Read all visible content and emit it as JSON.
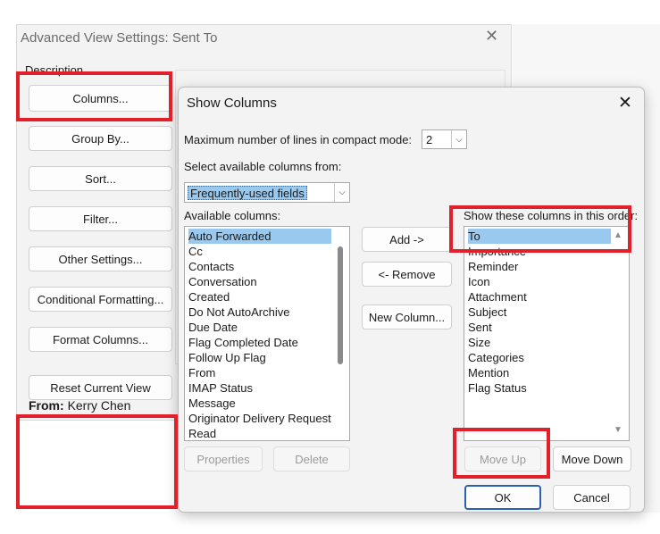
{
  "background_window": {
    "title": "Advanced View Settings: Sent To",
    "description_label": "Description",
    "buttons": {
      "columns": "Columns...",
      "group_by": "Group By...",
      "sort": "Sort...",
      "filter": "Filter...",
      "other_settings": "Other Settings...",
      "conditional_formatting": "Conditional Formatting...",
      "format_columns": "Format Columns...",
      "reset_current_view": "Reset Current View"
    },
    "from_label": "From:",
    "from_value": "Kerry Chen"
  },
  "dialog": {
    "title": "Show Columns",
    "max_lines_label": "Maximum number of lines in compact mode:",
    "max_lines_value": "2",
    "select_from_label": "Select available columns from:",
    "select_from_value": "Frequently-used fields",
    "available_label": "Available columns:",
    "available_items": [
      "Auto Forwarded",
      "Cc",
      "Contacts",
      "Conversation",
      "Created",
      "Do Not AutoArchive",
      "Due Date",
      "Flag Completed Date",
      "Follow Up Flag",
      "From",
      "IMAP Status",
      "Message",
      "Originator Delivery Request",
      "Read"
    ],
    "available_selected": "Auto Forwarded",
    "show_label": "Show these columns in this order:",
    "show_items": [
      "To",
      "Importance",
      "Reminder",
      "Icon",
      "Attachment",
      "Subject",
      "Sent",
      "Size",
      "Categories",
      "Mention",
      "Flag Status"
    ],
    "show_selected": "To",
    "buttons": {
      "add": "Add ->",
      "remove": "<- Remove",
      "new_column": "New Column...",
      "properties": "Properties",
      "delete": "Delete",
      "move_up": "Move Up",
      "move_down": "Move Down",
      "ok": "OK",
      "cancel": "Cancel"
    }
  },
  "colors": {
    "highlight_red": "#e2202a",
    "selection_blue": "#99c9ef",
    "primary_border": "#2b5fb3"
  }
}
